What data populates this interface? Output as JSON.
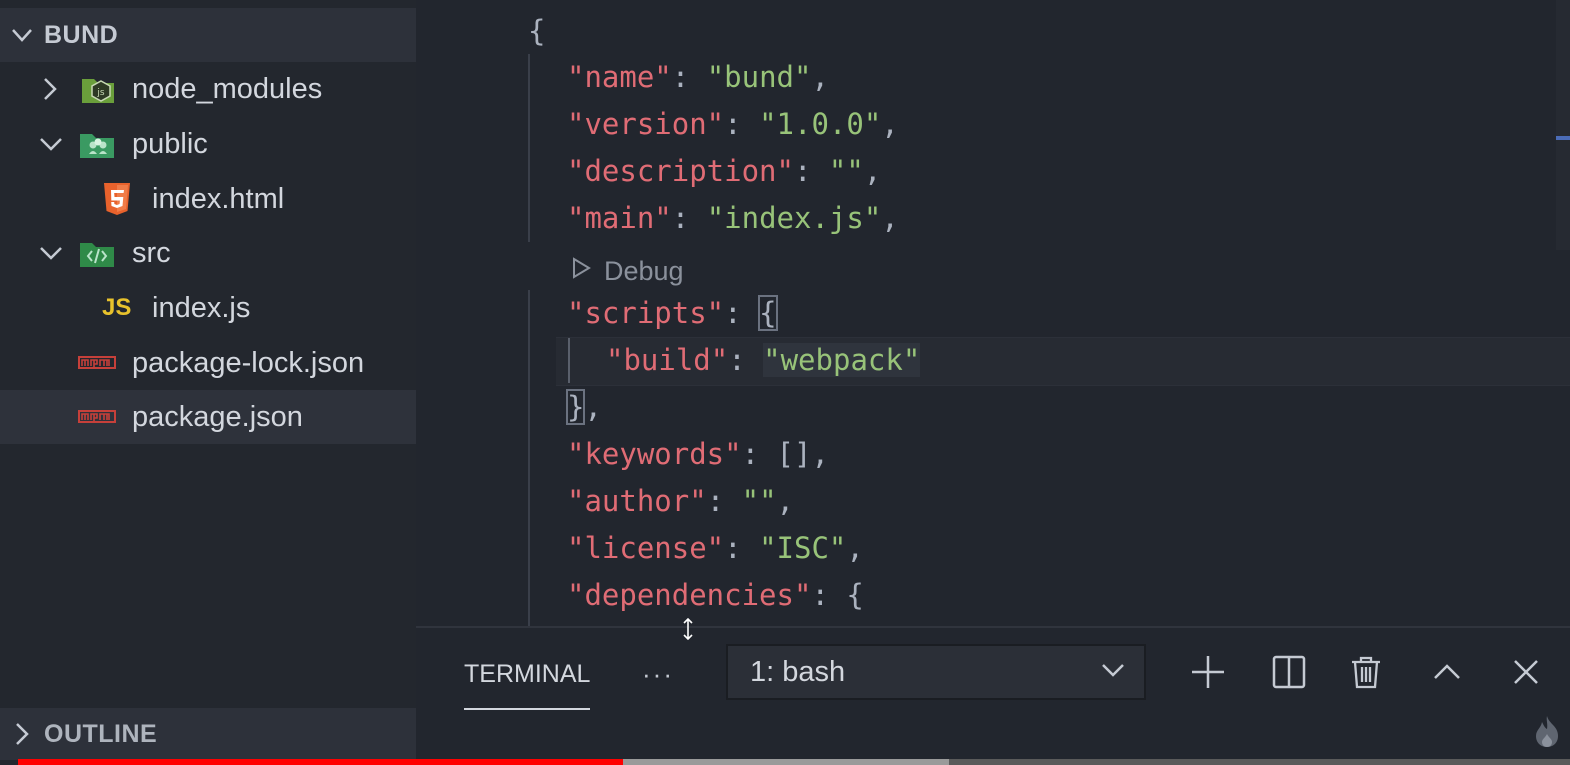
{
  "explorer": {
    "folder_title": "BUND",
    "items": [
      {
        "label": "node_modules",
        "type": "folder",
        "expanded": false,
        "icon": "node-modules-folder-icon"
      },
      {
        "label": "public",
        "type": "folder",
        "expanded": true,
        "icon": "public-folder-icon"
      },
      {
        "label": "index.html",
        "type": "file",
        "icon": "html5-icon"
      },
      {
        "label": "src",
        "type": "folder",
        "expanded": true,
        "icon": "src-folder-icon"
      },
      {
        "label": "index.js",
        "type": "file",
        "icon": "js-file-icon",
        "icon_text": "JS"
      },
      {
        "label": "package-lock.json",
        "type": "file",
        "icon": "npm-icon"
      },
      {
        "label": "package.json",
        "type": "file",
        "icon": "npm-icon",
        "selected": true
      }
    ],
    "outline_title": "OUTLINE"
  },
  "editor": {
    "codelens": "Debug",
    "lines": {
      "l1": "{",
      "name_key": "\"name\"",
      "name_val": "\"bund\"",
      "version_key": "\"version\"",
      "version_val": "\"1.0.0\"",
      "description_key": "\"description\"",
      "description_val": "\"\"",
      "main_key": "\"main\"",
      "main_val": "\"index.js\"",
      "scripts_key": "\"scripts\"",
      "build_key": "\"build\"",
      "build_val": "\"webpack\"",
      "keywords_key": "\"keywords\"",
      "keywords_val": "[]",
      "author_key": "\"author\"",
      "author_val": "\"\"",
      "license_key": "\"license\"",
      "license_val": "\"ISC\"",
      "dependencies_key": "\"dependencies\""
    }
  },
  "panel": {
    "tab_label": "TERMINAL",
    "more_label": "···",
    "terminal_select_value": "1: bash"
  },
  "video": {
    "played_fraction": 0.39,
    "buffered_fraction": 0.6
  },
  "colors": {
    "key": "#e06c75",
    "string": "#98c379",
    "progress": "#ff0000"
  }
}
